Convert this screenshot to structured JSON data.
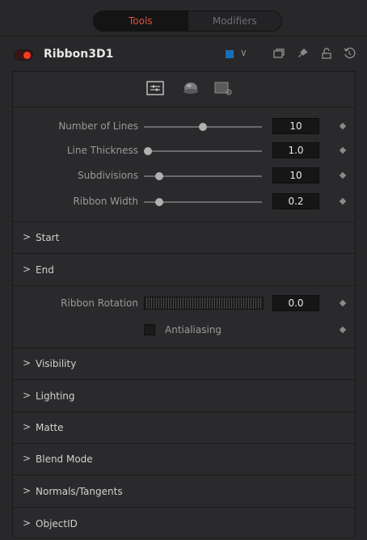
{
  "tabs": {
    "tools": "Tools",
    "modifiers": "Modifiers"
  },
  "tool": {
    "name": "Ribbon3D1",
    "color": "#1a6fb4",
    "enabled_color": "#ff3b22"
  },
  "controls": {
    "number_of_lines": {
      "label": "Number of Lines",
      "value": "10",
      "level": 0.5
    },
    "line_thickness": {
      "label": "Line Thickness",
      "value": "1.0",
      "level": 0.0
    },
    "subdivisions": {
      "label": "Subdivisions",
      "value": "10",
      "level": 0.1
    },
    "ribbon_width": {
      "label": "Ribbon Width",
      "value": "0.2",
      "level": 0.1
    }
  },
  "sections": {
    "start": "Start",
    "end": "End",
    "visibility": "Visibility",
    "lighting": "Lighting",
    "matte": "Matte",
    "blend_mode": "Blend Mode",
    "normals": "Normals/Tangents",
    "objectid": "ObjectID"
  },
  "rotation": {
    "label": "Ribbon Rotation",
    "value": "0.0"
  },
  "antialiasing": {
    "label": "Antialiasing",
    "checked": false
  },
  "accent": "#e0533a"
}
